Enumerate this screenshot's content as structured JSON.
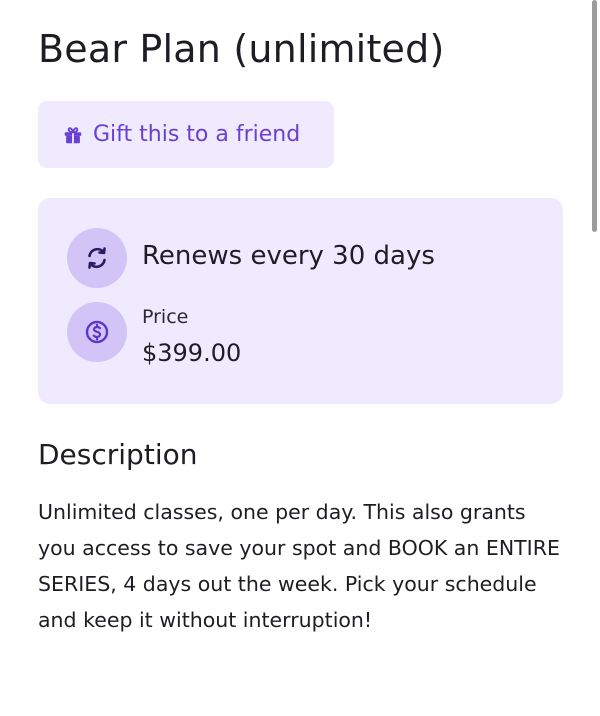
{
  "plan": {
    "title": "Bear Plan (unlimited)"
  },
  "gift": {
    "label": "Gift this to a friend",
    "icon": "gift-icon"
  },
  "details": {
    "renewal": {
      "icon": "refresh-icon",
      "text": "Renews every 30 days"
    },
    "price": {
      "icon": "dollar-icon",
      "label": "Price",
      "value": "$399.00"
    }
  },
  "description": {
    "heading": "Description",
    "body": "Unlimited classes, one per day. This also grants you access to save your spot and BOOK an ENTIRE SERIES, 4 days out the week. Pick your schedule and keep it without interruption!"
  },
  "colors": {
    "accent": "#6a3fd4",
    "card_background": "#efeafd",
    "icon_circle": "#d3c4f8",
    "text": "#1e1d24"
  }
}
